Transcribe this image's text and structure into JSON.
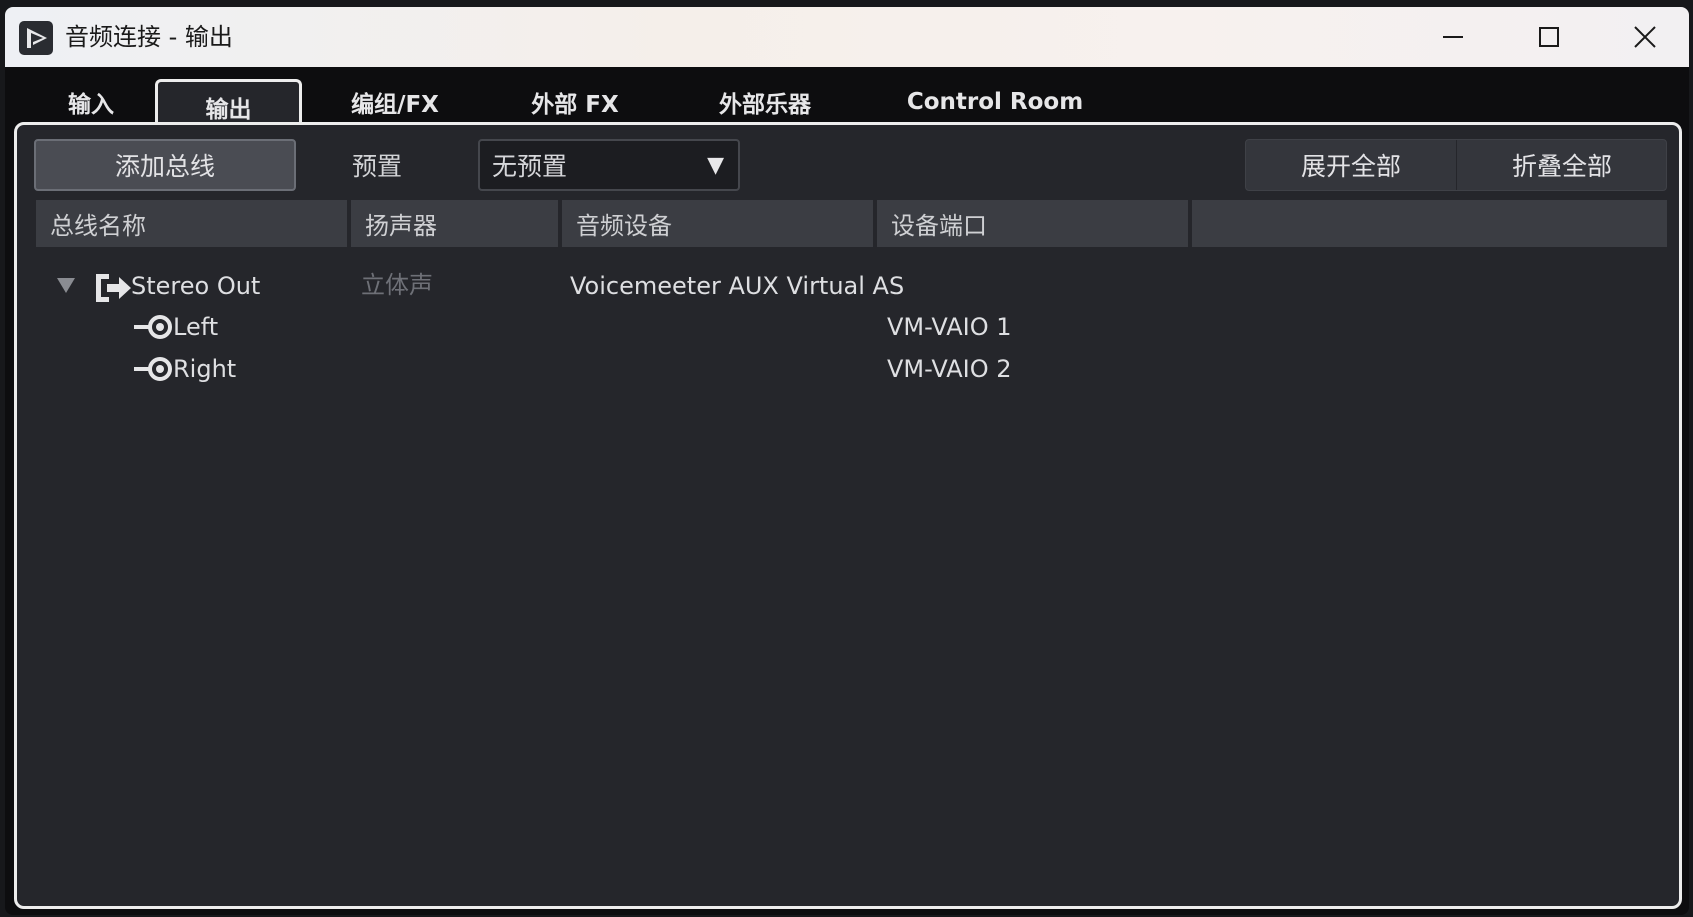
{
  "window": {
    "title": "音频连接 - 输出"
  },
  "tabs": [
    {
      "label": "输入",
      "active": false
    },
    {
      "label": "输出",
      "active": true
    },
    {
      "label": "编组/FX",
      "active": false
    },
    {
      "label": "外部 FX",
      "active": false
    },
    {
      "label": "外部乐器",
      "active": false
    },
    {
      "label": "Control Room",
      "active": false
    }
  ],
  "toolbar": {
    "add_bus_label": "添加总线",
    "preset_label": "预置",
    "preset_value": "无预置",
    "expand_all_label": "展开全部",
    "collapse_all_label": "折叠全部"
  },
  "columns": [
    "总线名称",
    "扬声器",
    "音频设备",
    "设备端口",
    ""
  ],
  "buses": [
    {
      "name": "Stereo Out",
      "speaker": "立体声",
      "audio_device": "Voicemeeter AUX Virtual AS",
      "expanded": true,
      "channels": [
        {
          "name": "Left",
          "port": "VM-VAIO 1"
        },
        {
          "name": "Right",
          "port": "VM-VAIO 2"
        }
      ]
    }
  ],
  "icons": {
    "app": "cubase-logo-icon",
    "bus": "output-bus-icon",
    "channel": "speaker-channel-icon",
    "tree": "triangle-down-icon"
  },
  "colors": {
    "panel_bg": "#25262b",
    "header_bg": "#3b3d43",
    "border_light": "#ededed",
    "text": "#dedfe2",
    "muted_text": "#6e7077"
  }
}
